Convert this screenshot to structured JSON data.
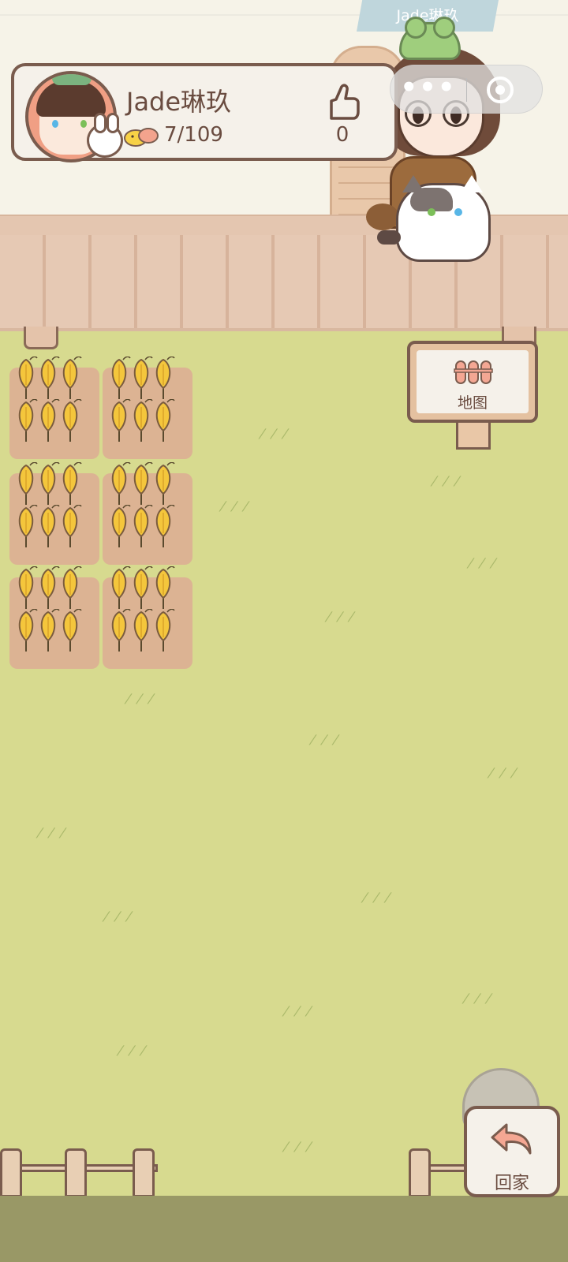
{
  "player": {
    "banner_name": "Jade琳玖",
    "name": "Jade琳玖",
    "exp_text": "7/109",
    "likes": "0"
  },
  "nav": {
    "map_label": "地图",
    "home_label": "回家"
  },
  "icons": {
    "more": "•••",
    "close": "record-icon"
  },
  "colors": {
    "grass": "#d7da8f",
    "panel": "#f5f1ea",
    "outline": "#7a5c4e",
    "soil": "#dcb393",
    "crop": "#f4c63c",
    "text": "#6a4c40"
  },
  "farm": {
    "plots": [
      {
        "crop": "wheat",
        "stage": "ripe"
      },
      {
        "crop": "wheat",
        "stage": "ripe"
      },
      {
        "crop": "wheat",
        "stage": "ripe"
      },
      {
        "crop": "wheat",
        "stage": "ripe"
      },
      {
        "crop": "wheat",
        "stage": "ripe"
      },
      {
        "crop": "wheat",
        "stage": "ripe"
      }
    ]
  }
}
